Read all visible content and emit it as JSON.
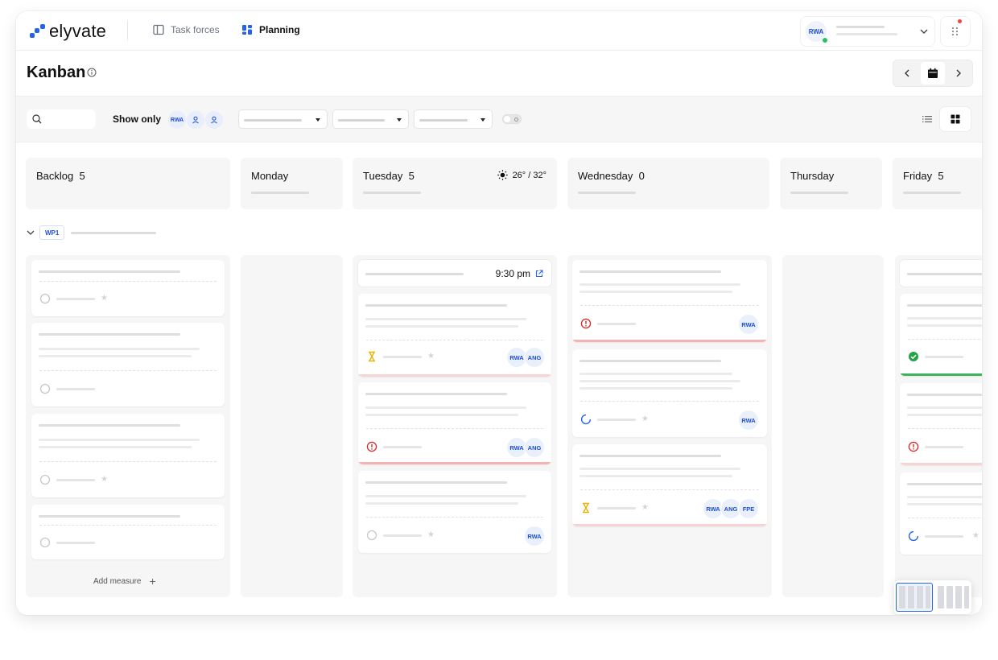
{
  "app": {
    "name": "elyvate"
  },
  "nav": {
    "tabs": [
      {
        "label": "Task forces"
      },
      {
        "label": "Planning"
      }
    ],
    "user_initials": "RWA"
  },
  "page": {
    "title": "Kanban"
  },
  "filters": {
    "search_placeholder": "",
    "show_only_label": "Show only",
    "chip_initials": "RWA"
  },
  "columns": [
    {
      "name": "Backlog",
      "count": "5"
    },
    {
      "name": "Monday",
      "count": ""
    },
    {
      "name": "Tuesday",
      "count": "5",
      "weather": "26° / 32°"
    },
    {
      "name": "Wednesday",
      "count": "0"
    },
    {
      "name": "Thursday",
      "count": ""
    },
    {
      "name": "Friday",
      "count": "5"
    }
  ],
  "group": {
    "label": "WP1"
  },
  "backlog": {
    "add_label": "Add measure",
    "add_symbol": "+"
  },
  "tuesday": {
    "time": "9:30 pm",
    "cards": [
      {
        "avatars": [
          "RWA",
          "ANG"
        ]
      },
      {
        "avatars": [
          "RWA",
          "ANG"
        ]
      },
      {
        "avatars": [
          "RWA"
        ]
      }
    ]
  },
  "wednesday": {
    "cards": [
      {
        "avatars": [
          "RWA"
        ]
      },
      {
        "avatars": [
          "RWA"
        ]
      },
      {
        "avatars": [
          "RWA",
          "ANG",
          "FPE"
        ]
      }
    ]
  },
  "colors": {
    "accent": "#2563eb",
    "danger": "#dc2626",
    "success": "#22a447",
    "warning": "#eab308"
  }
}
